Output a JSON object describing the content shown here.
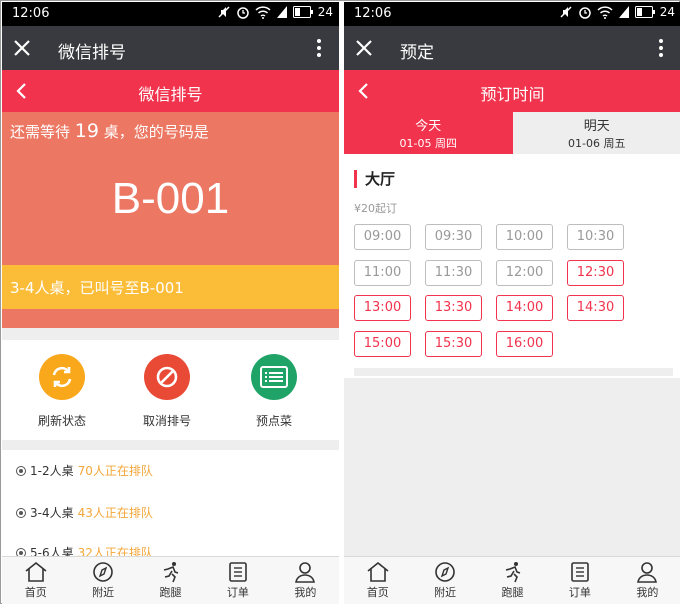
{
  "left": {
    "status": {
      "time": "12:06",
      "battery": "24"
    },
    "wx_title": "微信排号",
    "page_title": "微信排号",
    "wait_prefix": "还需等待",
    "wait_count": "19",
    "wait_suffix": "桌，您的号码是",
    "ticket": "B-001",
    "called_text": "3-4人桌，已叫号至B-001",
    "actions": [
      {
        "label": "刷新状态",
        "color": "#f9a71b",
        "icon": "refresh-icon"
      },
      {
        "label": "取消排号",
        "color": "#e94a36",
        "icon": "cancel-icon"
      },
      {
        "label": "预点菜",
        "color": "#1fa367",
        "icon": "menu-icon"
      }
    ],
    "queues": [
      {
        "table": "1-2人桌",
        "count": "70人正在排队"
      },
      {
        "table": "3-4人桌",
        "count": "43人正在排队"
      },
      {
        "table": "5-6人桌",
        "count": "32人正在排队"
      }
    ]
  },
  "right": {
    "status": {
      "time": "12:06",
      "battery": "24"
    },
    "wx_title": "预定",
    "page_title": "预订时间",
    "days": [
      {
        "label": "今天",
        "date": "01-05 周四",
        "active": true
      },
      {
        "label": "明天",
        "date": "01-06 周五",
        "active": false
      }
    ],
    "section": "大厅",
    "price": "¥20起订",
    "slots": [
      {
        "time": "09:00",
        "available": false
      },
      {
        "time": "09:30",
        "available": false
      },
      {
        "time": "10:00",
        "available": false
      },
      {
        "time": "10:30",
        "available": false
      },
      {
        "time": "11:00",
        "available": false
      },
      {
        "time": "11:30",
        "available": false
      },
      {
        "time": "12:00",
        "available": false
      },
      {
        "time": "12:30",
        "available": true
      },
      {
        "time": "13:00",
        "available": true
      },
      {
        "time": "13:30",
        "available": true
      },
      {
        "time": "14:00",
        "available": true
      },
      {
        "time": "14:30",
        "available": true
      },
      {
        "time": "15:00",
        "available": true
      },
      {
        "time": "15:30",
        "available": true
      },
      {
        "time": "16:00",
        "available": true
      }
    ]
  },
  "tabs": [
    {
      "label": "首页",
      "icon": "home-icon"
    },
    {
      "label": "附近",
      "icon": "compass-icon"
    },
    {
      "label": "跑腿",
      "icon": "runner-icon"
    },
    {
      "label": "订单",
      "icon": "order-icon"
    },
    {
      "label": "我的",
      "icon": "user-icon"
    }
  ],
  "colors": {
    "accent": "#f2334d",
    "queue_bg": "#ec7763",
    "called_bg": "#fbbc37",
    "queue_count": "#f3a73a"
  }
}
